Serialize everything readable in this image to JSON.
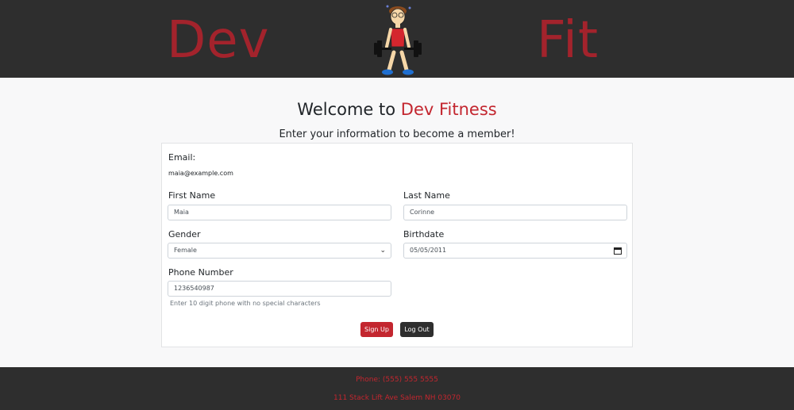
{
  "header": {
    "brand_left": "Dev",
    "brand_right": "Fit",
    "logo_icon": "weightlifter-cartoon-icon"
  },
  "page": {
    "title_prefix": "Welcome to ",
    "title_accent": "Dev Fitness",
    "subtitle": "Enter your information to become a member!"
  },
  "form": {
    "email_label": "Email:",
    "email_value": "maia@example.com",
    "first_name_label": "First Name",
    "first_name_value": "Maia",
    "last_name_label": "Last Name",
    "last_name_value": "Corinne",
    "gender_label": "Gender",
    "gender_value": "Female",
    "birthdate_label": "Birthdate",
    "birthdate_value": "05/05/2011",
    "phone_label": "Phone Number",
    "phone_value": "1236540987",
    "phone_help": "Enter 10 digit phone with no special characters",
    "signup_label": "Sign Up",
    "logout_label": "Log Out"
  },
  "footer": {
    "phone": "Phone: (555) 555 5555",
    "address": "111 Stack Lift Ave Salem NH 03070"
  },
  "colors": {
    "accent": "#c3262f",
    "header_bg": "#2e2e2e"
  }
}
